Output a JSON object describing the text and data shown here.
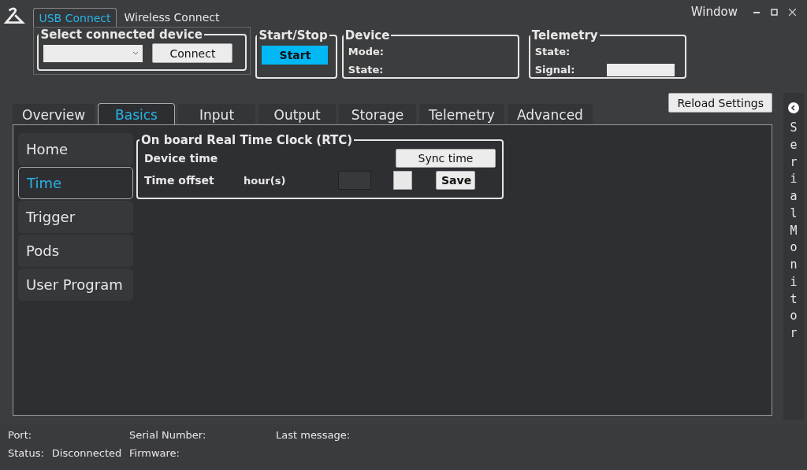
{
  "window": {
    "title": "Window"
  },
  "connection_tabs": [
    {
      "label": "USB Connect",
      "selected": true
    },
    {
      "label": "Wireless Connect",
      "selected": false
    }
  ],
  "select_device": {
    "title": "Select connected device",
    "connect_button": "Connect"
  },
  "start_stop": {
    "title": "Start/Stop",
    "button": "Start"
  },
  "device": {
    "title": "Device",
    "fields": [
      "Mode:",
      "State:"
    ]
  },
  "telemetry": {
    "title": "Telemetry",
    "state_label": "State:",
    "signal_label": "Signal:"
  },
  "tabs": [
    {
      "label": "Overview",
      "selected": false
    },
    {
      "label": "Basics",
      "selected": true
    },
    {
      "label": "Input",
      "selected": false
    },
    {
      "label": "Output",
      "selected": false
    },
    {
      "label": "Storage",
      "selected": false
    },
    {
      "label": "Telemetry",
      "selected": false
    },
    {
      "label": "Advanced",
      "selected": false
    }
  ],
  "reload_button": "Reload Settings",
  "sidebar": {
    "items": [
      {
        "label": "Home",
        "selected": false
      },
      {
        "label": "Time",
        "selected": true
      },
      {
        "label": "Trigger",
        "selected": false
      },
      {
        "label": "Pods",
        "selected": false
      },
      {
        "label": "User Program",
        "selected": false
      }
    ]
  },
  "rtc": {
    "title": "On board Real Time Clock (RTC)",
    "device_time_label": "Device time",
    "sync_button": "Sync time",
    "offset_label": "Time offset",
    "unit": "hour(s)",
    "save_button": "Save"
  },
  "serial_monitor": {
    "label": "Serial Monitor"
  },
  "status_bar": {
    "port_label": "Port:",
    "serial_label": "Serial Number:",
    "last_message_label": "Last message:",
    "status_label": "Status:",
    "status_value": "Disconnected",
    "firmware_label": "Firmware:"
  }
}
